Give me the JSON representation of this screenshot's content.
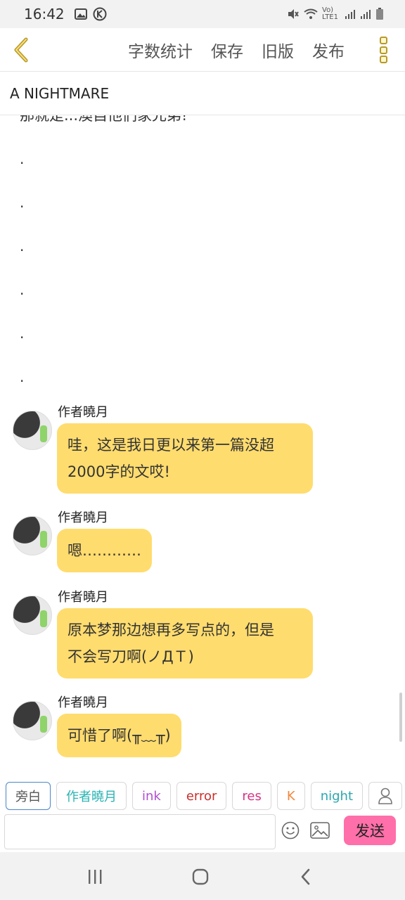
{
  "status": {
    "time": "16:42",
    "network_label": "Vo) LTE1"
  },
  "toolbar": {
    "actions": [
      "字数统计",
      "保存",
      "旧版",
      "发布"
    ]
  },
  "title": "A NIGHTMARE",
  "content": {
    "clipped_line": "那就是...澳自他们家兄弟!",
    "dots": [
      ".",
      ".",
      ".",
      ".",
      ".",
      "."
    ]
  },
  "messages": [
    {
      "author": "作者曉月",
      "text": "哇，这是我日更以来第一篇没超\n2000字的文哎!"
    },
    {
      "author": "作者曉月",
      "text": "嗯…………"
    },
    {
      "author": "作者曉月",
      "text": "原本梦那边想再多写点的，但是\n不会写刀啊(ノДＴ)"
    },
    {
      "author": "作者曉月",
      "text": "可惜了啊(╥﹏╥)"
    }
  ],
  "roles": [
    {
      "label": "旁白",
      "color": "#555555"
    },
    {
      "label": "作者曉月",
      "color": "#2bb3b3"
    },
    {
      "label": "ink",
      "color": "#b04fcf"
    },
    {
      "label": "error",
      "color": "#c9302c"
    },
    {
      "label": "res",
      "color": "#d63384"
    },
    {
      "label": "K",
      "color": "#f0883e"
    },
    {
      "label": "night",
      "color": "#2aa7b0"
    }
  ],
  "composer": {
    "placeholder": "",
    "send_label": "发送"
  },
  "colors": {
    "bubble": "#ffdc6e",
    "send": "#ff6fa9",
    "back_arrow": "#b59a2c"
  }
}
